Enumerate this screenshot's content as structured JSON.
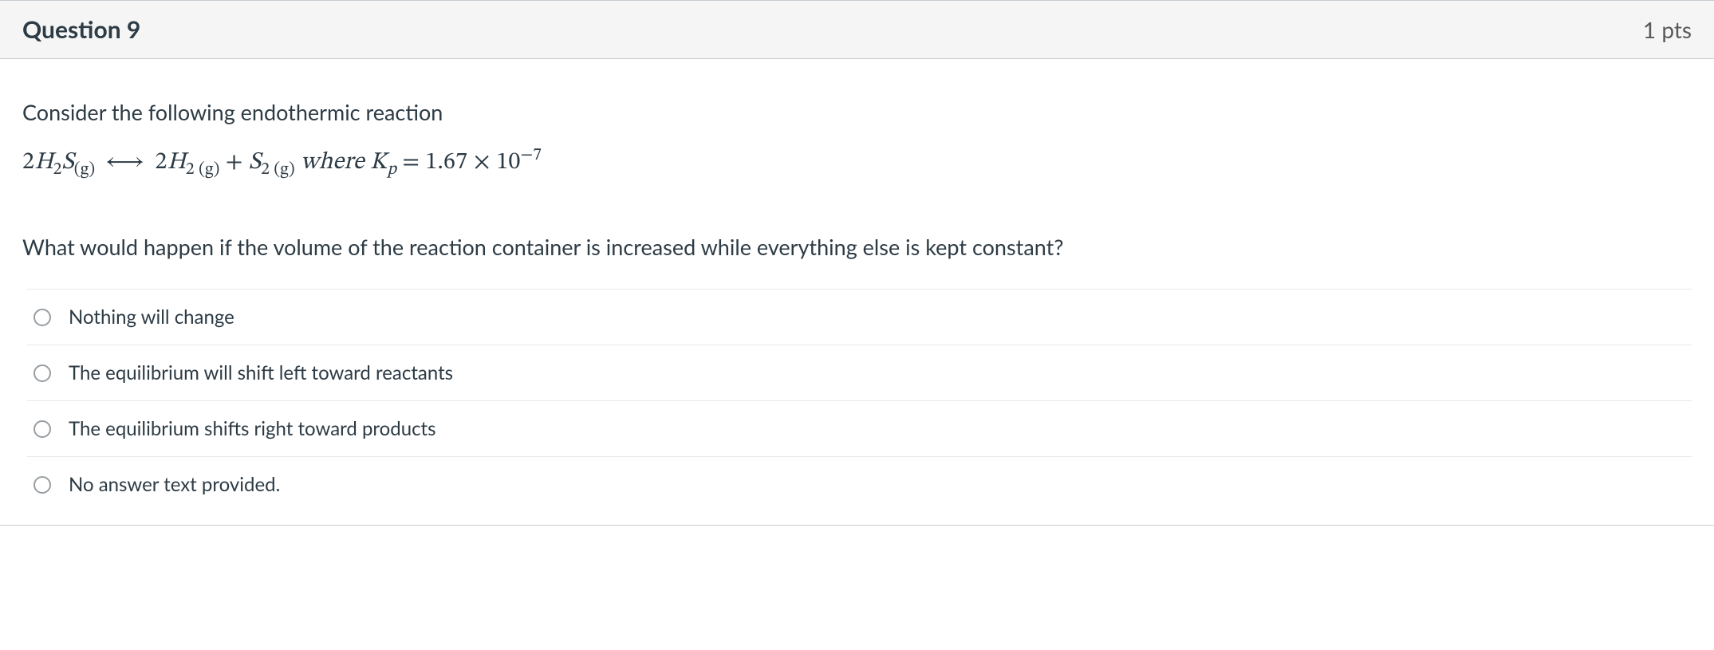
{
  "header": {
    "title": "Question 9",
    "points": "1 pts"
  },
  "body": {
    "intro": "Consider the following endothermic reaction",
    "followup": "What would happen if the volume of the reaction container is increased while everything else is kept constant?"
  },
  "equation": {
    "lhs_coef": "2",
    "lhs_sym": "H",
    "lhs_sub1": "2",
    "lhs_sym2": "S",
    "lhs_phase": "(g)",
    "arrow": "⟷",
    "r1_coef": "2",
    "r1_sym": "H",
    "r1_sub": "2 (g)",
    "plus": " + ",
    "r2_sym": "S",
    "r2_sub": "2 (g)",
    "where": "  where ",
    "K": "K",
    "Ksub": "p",
    "eq": " = 1.67 × 10",
    "exp": "−7"
  },
  "answers": [
    {
      "label": "Nothing will change"
    },
    {
      "label": "The equilibrium will shift left toward reactants"
    },
    {
      "label": "The equilibrium shifts right toward products"
    },
    {
      "label": "No answer text provided."
    }
  ]
}
